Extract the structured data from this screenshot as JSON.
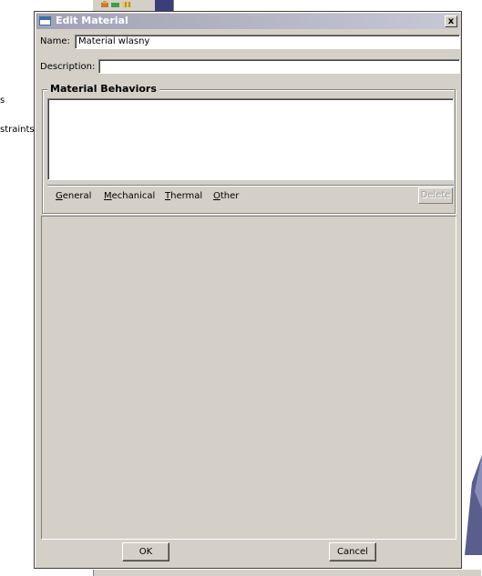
{
  "background": {
    "side_texts": [
      "s",
      "straints"
    ]
  },
  "dialog": {
    "title": "Edit Material",
    "close_label": "x",
    "name_label": "Name:",
    "name_value": "Material wlasny",
    "description_label": "Description:",
    "description_value": "",
    "behaviors_title": "Material Behaviors",
    "menus": [
      {
        "prefix": "",
        "mnemonic": "G",
        "rest": "eneral"
      },
      {
        "prefix": "",
        "mnemonic": "M",
        "rest": "echanical"
      },
      {
        "prefix": "",
        "mnemonic": "T",
        "rest": "hermal"
      },
      {
        "prefix": "",
        "mnemonic": "O",
        "rest": "ther"
      }
    ],
    "delete_label": "Delete",
    "ok_label": "OK",
    "cancel_label": "Cancel"
  }
}
